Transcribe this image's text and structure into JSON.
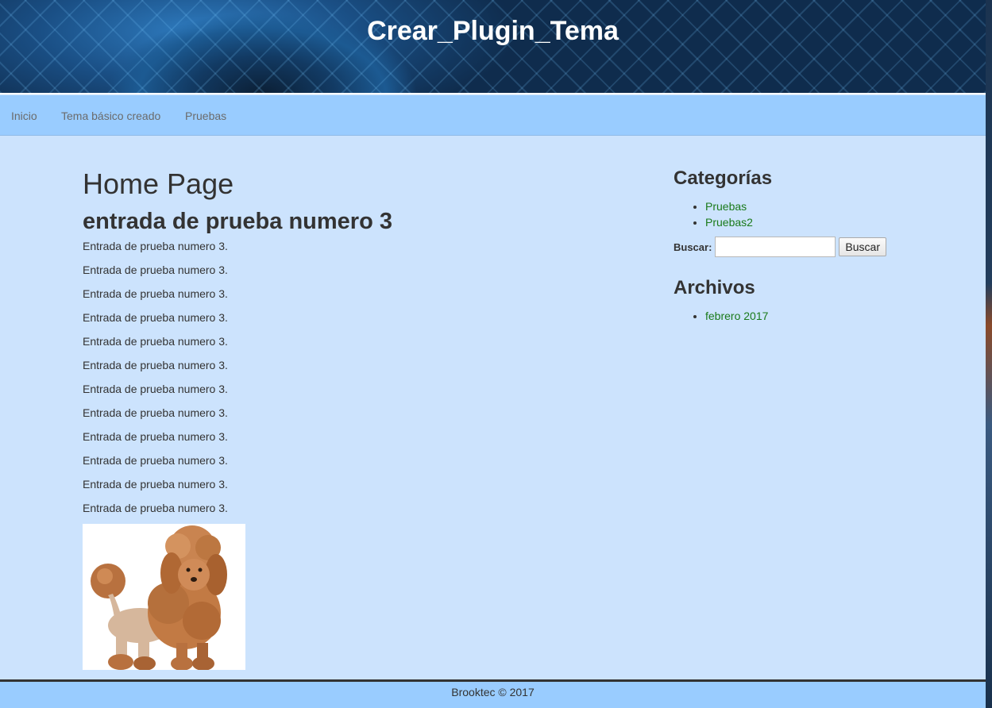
{
  "header": {
    "site_title": "Crear_Plugin_Tema"
  },
  "nav": {
    "items": [
      {
        "label": "Inicio"
      },
      {
        "label": "Tema básico creado"
      },
      {
        "label": "Pruebas"
      }
    ]
  },
  "main": {
    "page_title": "Home Page",
    "post": {
      "title": "entrada de prueba numero 3",
      "paragraphs": [
        "Entrada de prueba numero 3.",
        "Entrada de prueba numero 3.",
        "Entrada de prueba numero 3.",
        "Entrada de prueba numero 3.",
        "Entrada de prueba numero 3.",
        "Entrada de prueba numero 3.",
        "Entrada de prueba numero 3.",
        "Entrada de prueba numero 3.",
        "Entrada de prueba numero 3.",
        "Entrada de prueba numero 3.",
        "Entrada de prueba numero 3.",
        "Entrada de prueba numero 3."
      ]
    }
  },
  "sidebar": {
    "categories": {
      "title": "Categorías",
      "items": [
        {
          "label": "Pruebas"
        },
        {
          "label": "Pruebas2"
        }
      ]
    },
    "search": {
      "label": "Buscar:",
      "value": "",
      "button_label": "Buscar"
    },
    "archives": {
      "title": "Archivos",
      "items": [
        {
          "label": "febrero 2017"
        }
      ]
    }
  },
  "footer": {
    "text": "Brooktec © 2017"
  },
  "colors": {
    "page_background": "#cce3fd",
    "nav_background": "#99ccff",
    "link_color": "#1a7a1a",
    "footer_border": "#333333"
  }
}
